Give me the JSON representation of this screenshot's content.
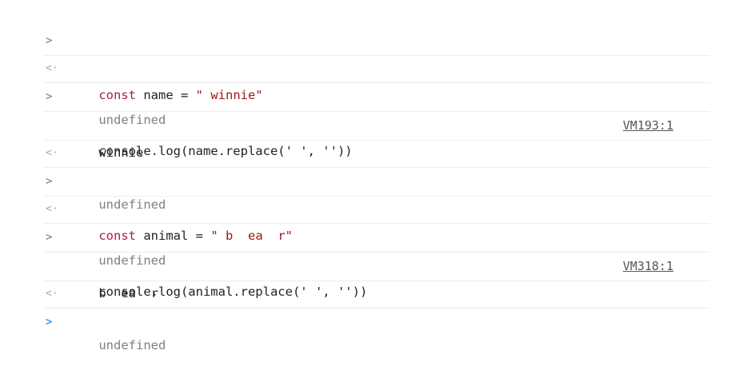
{
  "console": {
    "entries": [
      {
        "kind": "input",
        "prompt": ">",
        "parts": [
          "const",
          " name = ",
          "\" winnie\""
        ]
      },
      {
        "kind": "return",
        "prompt": "<·",
        "text": "undefined"
      },
      {
        "kind": "input",
        "prompt": ">",
        "text": "console.log(name.replace(' ', ''))"
      },
      {
        "kind": "log",
        "text": "winnie",
        "source": "VM193:1"
      },
      {
        "kind": "return",
        "prompt": "<·",
        "text": "undefined"
      },
      {
        "kind": "input",
        "prompt": ">",
        "parts": [
          "const",
          " animal = ",
          "\" b  ea  r\""
        ]
      },
      {
        "kind": "return",
        "prompt": "<·",
        "text": "undefined"
      },
      {
        "kind": "input",
        "prompt": ">",
        "text": "console.log(animal.replace(' ', ''))"
      },
      {
        "kind": "log",
        "text": "b  ea  r",
        "source": "VM318:1"
      },
      {
        "kind": "return",
        "prompt": "<·",
        "text": "undefined"
      },
      {
        "kind": "prompt",
        "prompt": ">"
      }
    ]
  },
  "colors": {
    "keyword": "#a21c5b",
    "string": "#a0181f",
    "undefined": "#808080",
    "active_prompt": "#1a73e8"
  },
  "icons": {
    "input_prompt": "chevron-right-icon",
    "return_prompt": "return-arrow-icon"
  }
}
